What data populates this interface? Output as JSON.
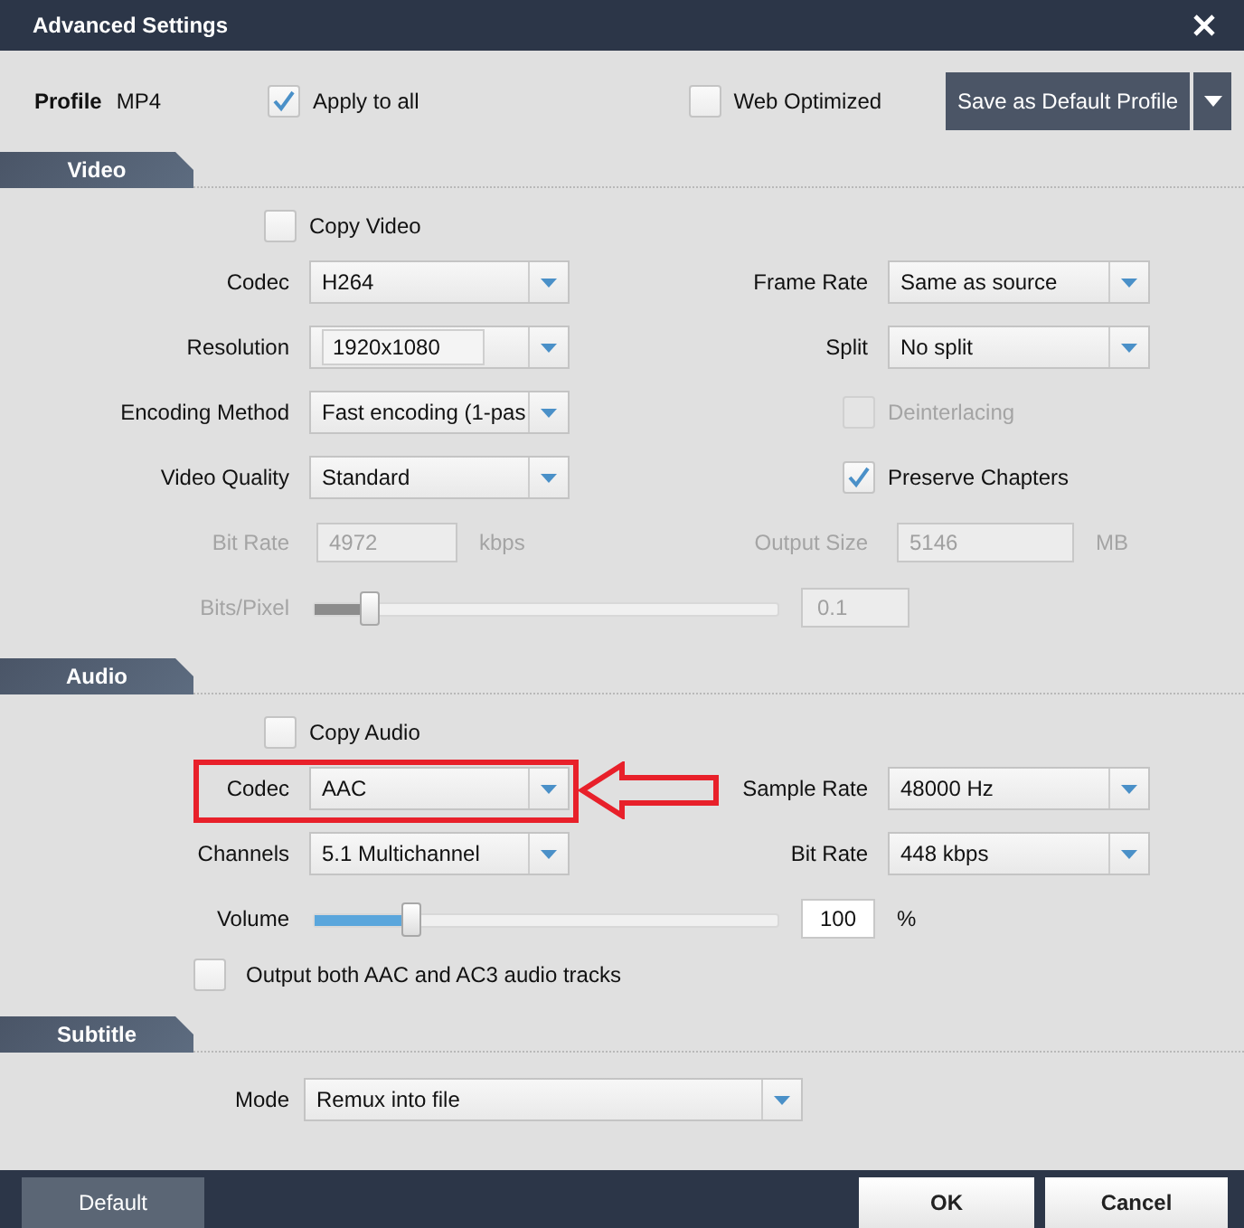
{
  "window": {
    "title": "Advanced Settings"
  },
  "profile": {
    "label": "Profile",
    "value": "MP4"
  },
  "apply_to_all": {
    "label": "Apply to all",
    "checked": true
  },
  "web_optimized": {
    "label": "Web Optimized",
    "checked": false
  },
  "save_button": {
    "label": "Save as Default Profile"
  },
  "sections": [
    {
      "title": "Video",
      "rows": [
        {
          "items": [
            {
              "kind": "checkbox",
              "label": "Copy Video",
              "checked": false,
              "disabled": false
            }
          ]
        },
        {
          "items": [
            {
              "kind": "select",
              "label": "Codec",
              "value": "H264",
              "editable": false
            },
            {
              "kind": "select",
              "label": "Frame Rate",
              "value": "Same as source",
              "editable": false
            }
          ]
        },
        {
          "items": [
            {
              "kind": "select",
              "label": "Resolution",
              "value": "1920x1080",
              "editable": true
            },
            {
              "kind": "select",
              "label": "Split",
              "value": "No split",
              "editable": false
            }
          ]
        },
        {
          "items": [
            {
              "kind": "select",
              "label": "Encoding Method",
              "value": "Fast encoding (1-pas",
              "editable": false
            },
            {
              "kind": "checkbox",
              "label": "Deinterlacing",
              "checked": false,
              "disabled": true
            }
          ]
        },
        {
          "items": [
            {
              "kind": "select",
              "label": "Video Quality",
              "value": "Standard",
              "editable": false
            },
            {
              "kind": "checkbox",
              "label": "Preserve Chapters",
              "checked": true,
              "disabled": false
            }
          ]
        },
        {
          "items": [
            {
              "kind": "input",
              "label": "Bit Rate",
              "value": "4972",
              "unit": "kbps",
              "disabled": true
            },
            {
              "kind": "input",
              "label": "Output Size",
              "value": "5146",
              "unit": "MB",
              "disabled": true
            }
          ]
        },
        {
          "items": [
            {
              "kind": "slider",
              "label": "Bits/Pixel",
              "level": 0.12,
              "value": "0.1",
              "disabled": true
            }
          ]
        }
      ]
    },
    {
      "title": "Audio",
      "rows": [
        {
          "items": [
            {
              "kind": "checkbox",
              "label": "Copy Audio",
              "checked": false,
              "disabled": false
            }
          ]
        },
        {
          "highlighted": true,
          "items": [
            {
              "kind": "select",
              "label": "Codec",
              "value": "AAC",
              "editable": false
            },
            {
              "kind": "select",
              "label": "Sample Rate",
              "value": "48000 Hz",
              "editable": false
            }
          ]
        },
        {
          "items": [
            {
              "kind": "select",
              "label": "Channels",
              "value": "5.1 Multichannel",
              "editable": false
            },
            {
              "kind": "select",
              "label": "Bit Rate",
              "value": "448 kbps",
              "editable": false
            }
          ]
        },
        {
          "items": [
            {
              "kind": "slider",
              "label": "Volume",
              "level": 0.21,
              "value": "100",
              "unit": "%",
              "disabled": false
            }
          ]
        },
        {
          "items": [
            {
              "kind": "wide_checkbox",
              "label": "Output both AAC and AC3 audio tracks",
              "checked": false,
              "disabled": false
            }
          ]
        }
      ]
    },
    {
      "title": "Subtitle",
      "rows": [
        {
          "items": [
            {
              "kind": "wide_select",
              "label": "Mode",
              "value": "Remux into file",
              "editable": false
            }
          ]
        }
      ]
    }
  ],
  "footer": {
    "default_button": "Default",
    "ok_button": "OK",
    "cancel_button": "Cancel"
  }
}
